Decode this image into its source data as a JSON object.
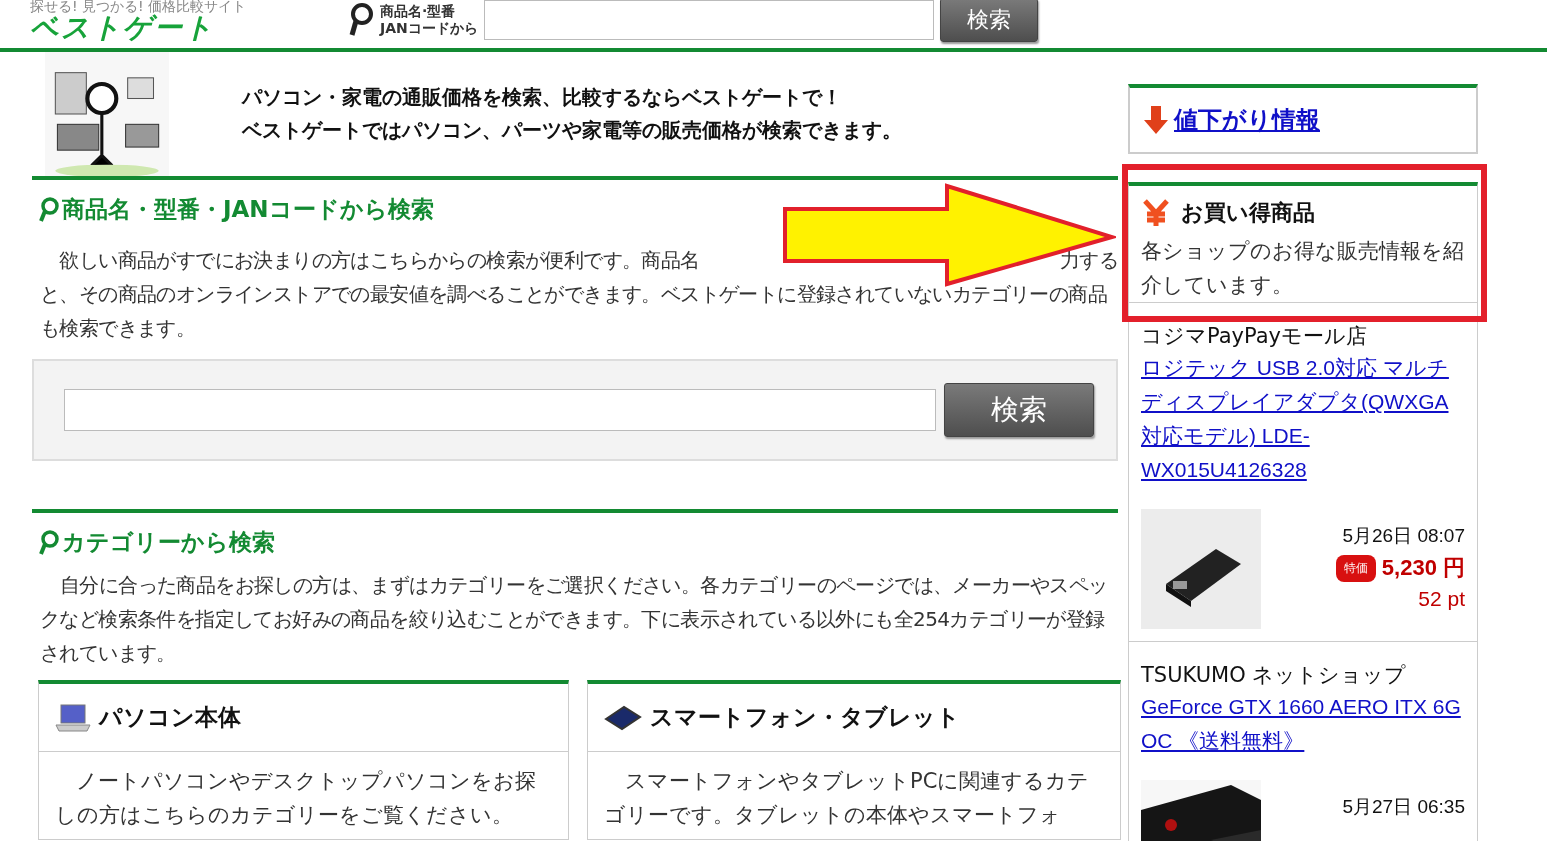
{
  "header": {
    "tagline": "探せる! 見つかる! 価格比較サイト",
    "logo": "ベストゲート",
    "search_label": [
      "商品名·型番",
      "JANコードから"
    ],
    "search_button": "検索"
  },
  "intro": {
    "lines": [
      "パソコン・家電の通販価格を検索、比較するならベストゲートで！",
      "ベストゲートではパソコン、パーツや家電等の販売価格が検索できます。"
    ]
  },
  "keyword_search": {
    "title": "商品名・型番・JANコードから検索",
    "text_parts": [
      "欲しい商品がすでにお決まりの方はこちらからの検索が便利です。商品名",
      "力する",
      "と、その商品のオンラインストアでの最安値を調べることができます。ベストゲートに登録されていないカテゴリーの商品も検索できます。"
    ],
    "button": "検索"
  },
  "category_search": {
    "title": "カテゴリーから検索",
    "text": "自分に合った商品をお探しの方は、まずはカテゴリーをご選択ください。各カテゴリーのページでは、メーカーやスペックなど検索条件を指定してお好みの商品を絞り込むことができます。下に表示されている以外にも全254カテゴリーが登録されています。",
    "categories": [
      {
        "kind": "laptop",
        "title": "パソコン本体",
        "text": "ノートパソコンやデスクトップパソコンをお探しの方はこちらのカテゴリーをご覧ください。"
      },
      {
        "kind": "phone",
        "title": "スマートフォン・タブレット",
        "text": "スマートフォンやタブレットPCに関連するカテゴリーです。タブレットの本体やスマートフォ"
      }
    ]
  },
  "sidebar": {
    "price_drop": "値下がり情報",
    "deals": {
      "title": "お買い得商品",
      "text": "各ショップのお得な販売情報を紹介しています。",
      "items": [
        {
          "shop": "コジマPayPayモール店",
          "product": "ロジテック USB 2.0対応 マルチディスプレイアダプタ(QWXGA対応モデル) LDE-WX015U4126328",
          "date": "5月26日 08:07",
          "badge": "特価",
          "price": "5,230 円",
          "points": "52 pt"
        },
        {
          "shop": "TSUKUMO ネットショップ",
          "product": "GeForce GTX 1660 AERO ITX 6G OC 《送料無料》",
          "date": "5月27日 06:35"
        }
      ]
    }
  }
}
